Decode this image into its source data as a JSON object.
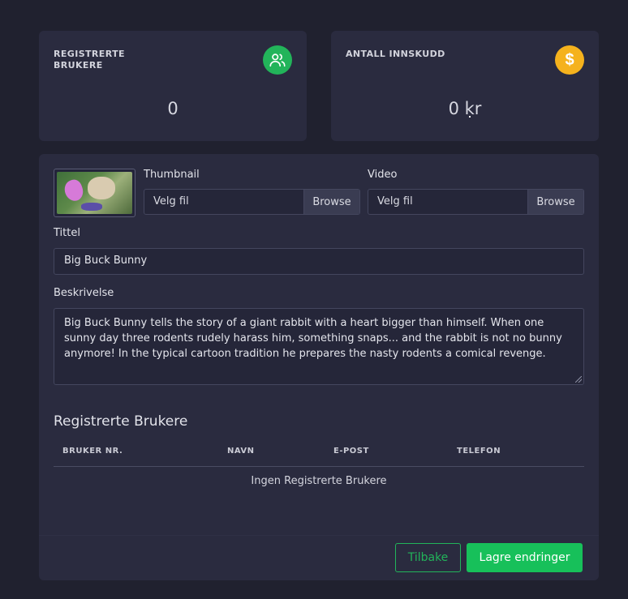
{
  "stats": [
    {
      "label": "REGISTRERTE BRUKERE",
      "value": "0",
      "icon": "users-icon",
      "color": "#22b45a"
    },
    {
      "label": "ANTALL INNSKUDD",
      "value": "0 kr",
      "icon": "dollar-icon",
      "color": "#f5b21d",
      "icon_glyph": "$"
    }
  ],
  "form": {
    "thumbnail_label": "Thumbnail",
    "video_label": "Video",
    "file_placeholder": "Velg fil",
    "browse_label": "Browse",
    "title_label": "Tittel",
    "title_value": "Big Buck Bunny",
    "description_label": "Beskrivelse",
    "description_value": "Big Buck Bunny tells the story of a giant rabbit with a heart bigger than himself. When one sunny day three rodents rudely harass him, something snaps... and the rabbit is not no bunny anymore! In the typical cartoon tradition he prepares the nasty rodents a comical revenge."
  },
  "users_section": {
    "title": "Registrerte Brukere",
    "columns": [
      "BRUKER NR.",
      "NAVN",
      "E-POST",
      "TELEFON"
    ],
    "empty_text": "Ingen Registrerte Brukere"
  },
  "actions": {
    "back_label": "Tilbake",
    "save_label": "Lagre endringer"
  }
}
